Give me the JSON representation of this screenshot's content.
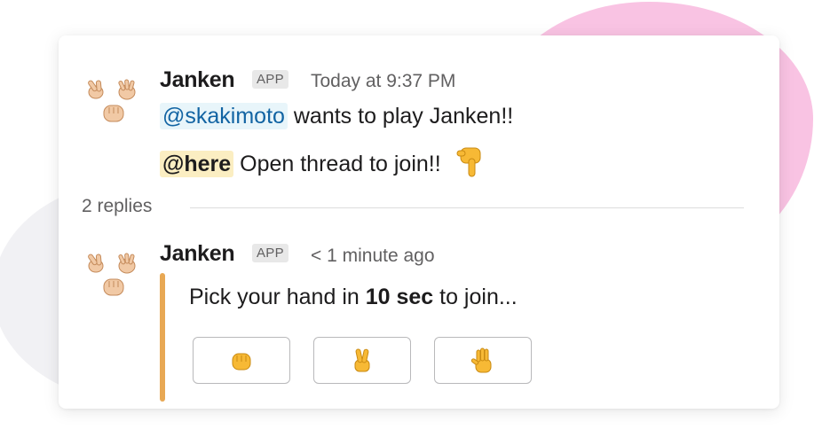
{
  "messages": [
    {
      "author": "Janken",
      "badge": "APP",
      "timestamp": "Today at 9:37 PM",
      "mention": "@skakimoto",
      "text1": " wants to play Janken!!",
      "here": "@here",
      "text2": " Open thread to join!!",
      "pointer_icon": "pointing-down-icon"
    },
    {
      "author": "Janken",
      "badge": "APP",
      "timestamp": "< 1 minute ago",
      "text_pre": "Pick your hand in ",
      "text_bold": "10 sec",
      "text_post": " to join..."
    }
  ],
  "thread": {
    "replies_label": "2 replies"
  },
  "buttons": [
    {
      "icon": "fist-icon"
    },
    {
      "icon": "victory-hand-icon"
    },
    {
      "icon": "raised-hand-icon"
    }
  ],
  "colors": {
    "pink_blob": "#f9c3e3",
    "accent_bar": "#e8a854",
    "mention_text": "#1264a3",
    "mention_bg": "#e8f5fa",
    "here_bg": "#fbeec2"
  }
}
